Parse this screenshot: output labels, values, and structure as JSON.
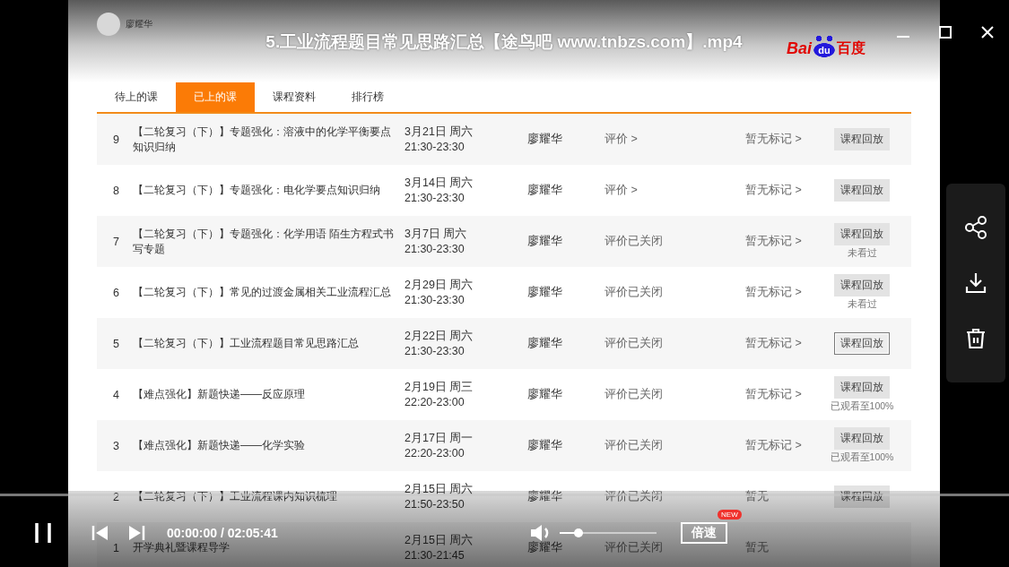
{
  "window": {
    "title": "5.工业流程题目常见思路汇总【途鸟吧 www.tnbzs.com】.mp4"
  },
  "video": {
    "teacher": "廖耀华",
    "logo": {
      "latin": "Bai",
      "paw": "du",
      "chinese": "百度"
    },
    "tabs": [
      {
        "label": "待上的课",
        "selected": false
      },
      {
        "label": "已上的课",
        "selected": true
      },
      {
        "label": "课程资料",
        "selected": false
      },
      {
        "label": "排行榜",
        "selected": false
      }
    ],
    "lessons": [
      {
        "number": "9",
        "title": "【二轮复习（下）】专题强化：溶液中的化学平衡要点知识归纳",
        "date": "3月21日 周六",
        "time": "21:30-23:30",
        "teacher": "廖耀华",
        "evaluation": "评价 >",
        "marks": "暂无标记 >",
        "button": "课程回放",
        "focused": false
      },
      {
        "number": "8",
        "title": "【二轮复习（下）】专题强化：电化学要点知识归纳",
        "date": "3月14日 周六",
        "time": "21:30-23:30",
        "teacher": "廖耀华",
        "evaluation": "评价 >",
        "marks": "暂无标记 >",
        "button": "课程回放",
        "focused": false
      },
      {
        "number": "7",
        "title": "【二轮复习（下）】专题强化：化学用语 陌生方程式书写专题",
        "date": "3月7日 周六",
        "time": "21:30-23:30",
        "teacher": "廖耀华",
        "evaluation": "评价已关闭",
        "marks": "暂无标记 >",
        "button": "课程回放",
        "note": "未看过",
        "focused": false
      },
      {
        "number": "6",
        "title": "【二轮复习（下）】常见的过渡金属相关工业流程汇总",
        "date": "2月29日 周六",
        "time": "21:30-23:30",
        "teacher": "廖耀华",
        "evaluation": "评价已关闭",
        "marks": "暂无标记 >",
        "button": "课程回放",
        "note": "未看过",
        "focused": false
      },
      {
        "number": "5",
        "title": "【二轮复习（下）】工业流程题目常见思路汇总",
        "date": "2月22日 周六",
        "time": "21:30-23:30",
        "teacher": "廖耀华",
        "evaluation": "评价已关闭",
        "marks": "暂无标记 >",
        "button": "课程回放",
        "focused": true
      },
      {
        "number": "4",
        "title": "【难点强化】新题快递——反应原理",
        "date": "2月19日 周三",
        "time": "22:20-23:00",
        "teacher": "廖耀华",
        "evaluation": "评价已关闭",
        "marks": "暂无标记 >",
        "button": "课程回放",
        "note": "已观看至100%",
        "focused": false
      },
      {
        "number": "3",
        "title": "【难点强化】新题快递——化学实验",
        "date": "2月17日 周一",
        "time": "22:20-23:00",
        "teacher": "廖耀华",
        "evaluation": "评价已关闭",
        "marks": "暂无标记 >",
        "button": "课程回放",
        "note": "已观看至100%",
        "focused": false
      },
      {
        "number": "2",
        "title": "【二轮复习（下）】工业流程课内知识梳理",
        "date": "2月15日 周六",
        "time": "21:50-23:50",
        "teacher": "廖耀华",
        "evaluation": "评价已关闭",
        "marks": "暂无",
        "button": "课程回放",
        "focused": false
      },
      {
        "number": "1",
        "title": "开学典礼暨课程导学",
        "date": "2月15日 周六",
        "time": "21:30-21:45",
        "teacher": "廖耀华",
        "evaluation": "评价已关闭",
        "marks": "暂无"
      }
    ]
  },
  "player": {
    "playing": true,
    "progress": {
      "level": 0
    },
    "time": "00:00:00 / 02:05:41",
    "volume": {
      "level": 0.2
    },
    "speed": {
      "label": "倍速",
      "badge": "NEW"
    }
  }
}
